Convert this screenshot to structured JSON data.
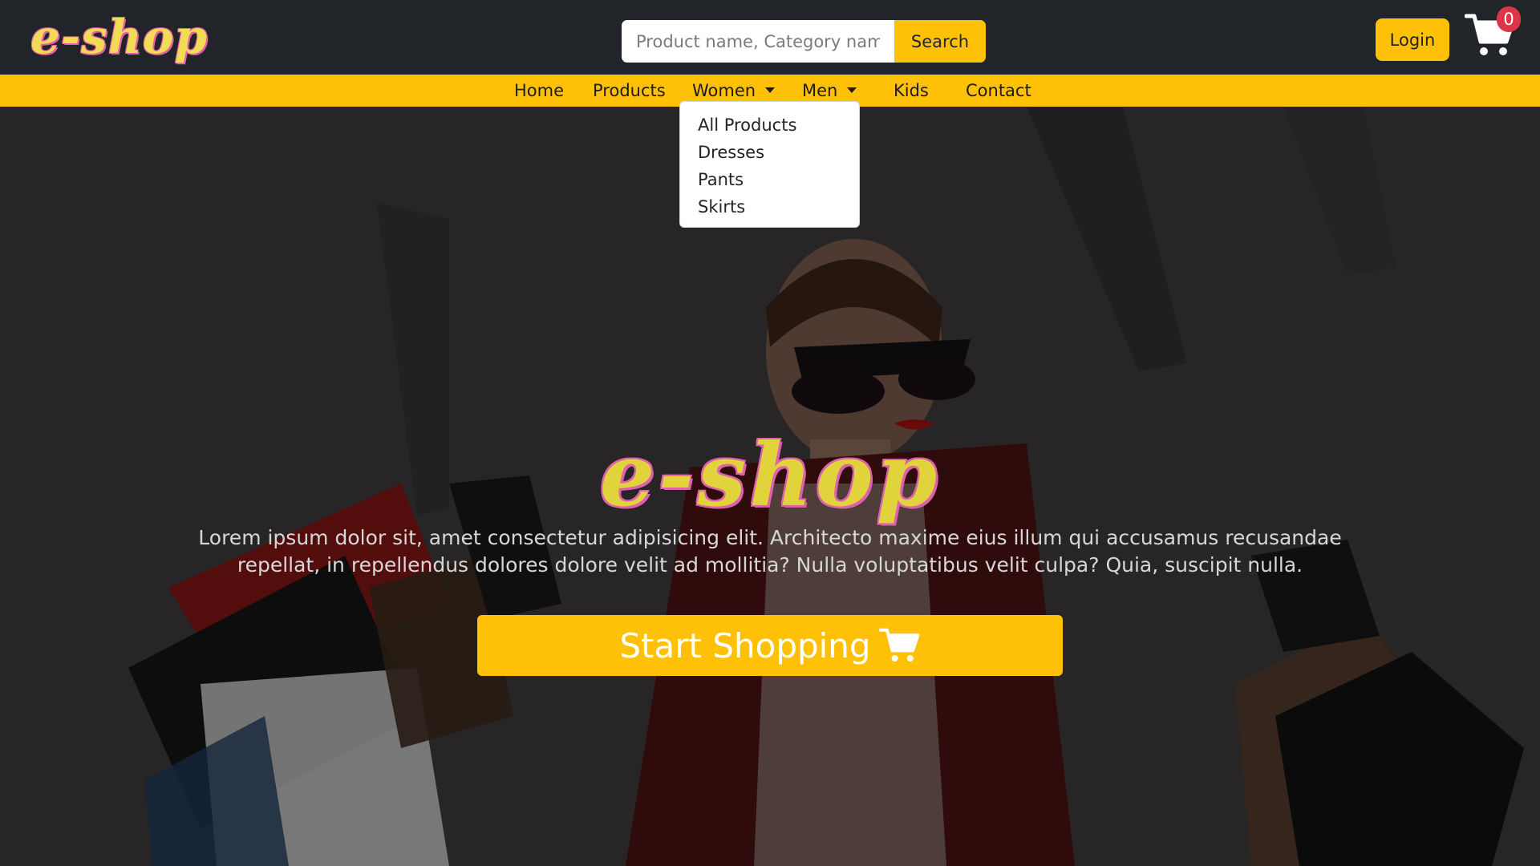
{
  "header": {
    "brand": "e-shop",
    "search": {
      "placeholder": "Product name, Category name",
      "value": "",
      "button_label": "Search"
    },
    "login_label": "Login",
    "cart": {
      "icon": "cart-icon",
      "count": "0"
    }
  },
  "nav": {
    "items": [
      {
        "label": "Home"
      },
      {
        "label": "Products"
      },
      {
        "label": "Women",
        "has_dropdown": true
      },
      {
        "label": "Men",
        "has_dropdown": true
      },
      {
        "label": "Kids"
      },
      {
        "label": "Contact"
      }
    ]
  },
  "dropdown": {
    "items": [
      "All Products",
      "Dresses",
      "Pants",
      "Skirts"
    ]
  },
  "hero": {
    "brand": "e-shop",
    "text": "Lorem ipsum dolor sit, amet consectetur adipisicing elit. Architecto maxime eius illum qui accusamus recusandae repellat, in repellendus dolores dolore velit ad mollitia? Nulla voluptatibus velit culpa? Quia, suscipit nulla.",
    "button_label": "Start Shopping",
    "button_icon": "cart-icon"
  },
  "colors": {
    "accent": "#ffc107",
    "header_bg": "#212529",
    "badge": "#dc3545",
    "brand_yellow": "#f2dc55",
    "brand_pink": "#e85fa8"
  }
}
